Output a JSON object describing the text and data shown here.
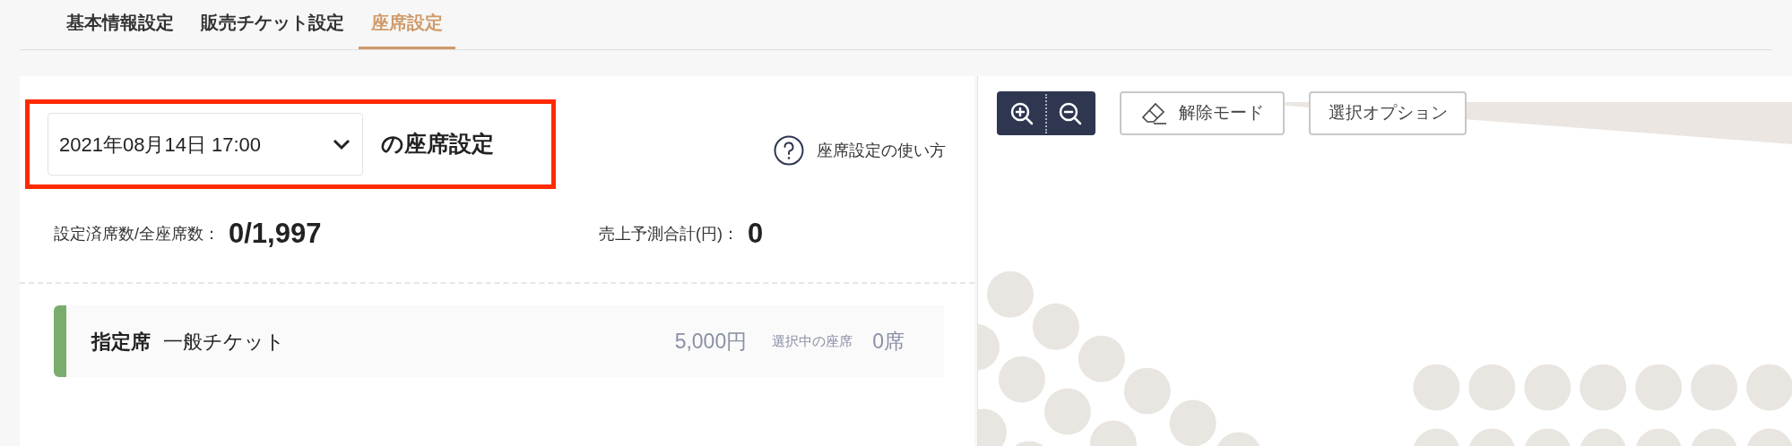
{
  "tabs": [
    {
      "label": "基本情報設定",
      "selected": false
    },
    {
      "label": "販売チケット設定",
      "selected": false
    },
    {
      "label": "座席設定",
      "selected": true
    }
  ],
  "performance": {
    "date_select": "2021年08月14日 17:00",
    "suffix": "の座席設定",
    "help_link": "座席設定の使い方"
  },
  "summary": [
    {
      "label": "設定済席数/全座席数：",
      "value": "0/1,997"
    },
    {
      "label": "売上予測合計(円)：",
      "value": "0"
    }
  ],
  "tickets": [
    {
      "seat_type": "指定席",
      "name": "一般チケット",
      "price": "5,000円",
      "selected_label": "選択中の座席",
      "selected_count": "0席",
      "color": "#7aad6c"
    }
  ],
  "toolbar": {
    "erase_mode": "解除モード",
    "select_options": "選択オプション"
  }
}
